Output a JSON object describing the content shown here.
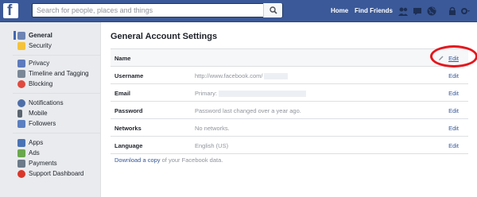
{
  "topbar": {
    "logo_letter": "f",
    "search_placeholder": "Search for people, places and things",
    "nav": [
      "Home",
      "Find Friends"
    ],
    "icons": [
      "friends-icon",
      "messages-icon",
      "globe-icon",
      "lock-icon",
      "settings-icon"
    ]
  },
  "sidebar": {
    "groups": [
      {
        "items": [
          {
            "label": "General",
            "icon": "gears-icon",
            "color": "#6d84b4",
            "active": true
          },
          {
            "label": "Security",
            "icon": "shield-icon",
            "color": "#f5c33b"
          }
        ]
      },
      {
        "items": [
          {
            "label": "Privacy",
            "icon": "privacy-icon",
            "color": "#5d7bbd"
          },
          {
            "label": "Timeline and Tagging",
            "icon": "timeline-icon",
            "color": "#7a8796"
          },
          {
            "label": "Blocking",
            "icon": "block-icon",
            "color": "#e04a3f"
          }
        ]
      },
      {
        "items": [
          {
            "label": "Notifications",
            "icon": "globe-icon",
            "color": "#4f6fa8"
          },
          {
            "label": "Mobile",
            "icon": "mobile-icon",
            "color": "#5b6470"
          },
          {
            "label": "Followers",
            "icon": "followers-icon",
            "color": "#5b7fc0"
          }
        ]
      },
      {
        "items": [
          {
            "label": "Apps",
            "icon": "apps-icon",
            "color": "#4a73b5"
          },
          {
            "label": "Ads",
            "icon": "ads-icon",
            "color": "#6aa84f"
          },
          {
            "label": "Payments",
            "icon": "payments-icon",
            "color": "#6c7a89"
          },
          {
            "label": "Support Dashboard",
            "icon": "lifebuoy-icon",
            "color": "#d9372a"
          }
        ]
      }
    ]
  },
  "main": {
    "title": "General Account Settings",
    "rows": [
      {
        "label": "Name",
        "value": "",
        "edit": "Edit"
      },
      {
        "label": "Username",
        "value": "http://www.facebook.com/",
        "edit": "Edit"
      },
      {
        "label": "Email",
        "value": "Primary:",
        "edit": "Edit"
      },
      {
        "label": "Password",
        "value": "Password last changed over a year ago.",
        "edit": "Edit"
      },
      {
        "label": "Networks",
        "value": "No networks.",
        "edit": "Edit"
      },
      {
        "label": "Language",
        "value": "English (US)",
        "edit": "Edit"
      }
    ],
    "download_link": "Download a copy",
    "download_rest": " of your Facebook data.",
    "highlight_color": "#e4161c"
  }
}
